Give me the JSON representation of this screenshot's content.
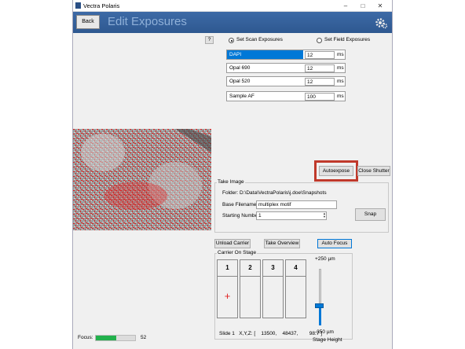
{
  "window": {
    "title": "Vectra Polaris",
    "min_icon": "minimize-icon",
    "max_icon": "maximize-icon",
    "close_icon": "close-icon"
  },
  "header": {
    "back_label": "Back",
    "title": "Edit Exposures",
    "settings_icon": "gear-icon"
  },
  "help_label": "?",
  "exposure_mode": {
    "scan_label": "Set Scan Exposures",
    "field_label": "Set Field Exposures",
    "selected": "scan"
  },
  "exposures": [
    {
      "name": "DAPI",
      "value": "12",
      "unit": "ms"
    },
    {
      "name": "Opal 690",
      "value": "12",
      "unit": "ms"
    },
    {
      "name": "Opal 520",
      "value": "12",
      "unit": "ms"
    },
    {
      "name": "Sample AF",
      "value": "100",
      "unit": "ms"
    }
  ],
  "buttons": {
    "autoexpose": "Autoexpose",
    "close_shutter": "Close Shutter",
    "snap": "Snap",
    "unload_carrier": "Unload Carrier",
    "take_overview": "Take Overview",
    "auto_focus": "Auto Focus"
  },
  "take_image": {
    "group_label": "Take Image",
    "folder_text": "Folder:  D:\\Data\\VectraPolaris\\j.doe\\Snapshots",
    "base_filename_label": "Base Filename:",
    "base_filename_value": "multiplex motif",
    "starting_number_label": "Starting Number:",
    "starting_number_value": "1"
  },
  "carrier": {
    "group_label": "Carrier On Stage",
    "slots": [
      "1",
      "2",
      "3",
      "4"
    ],
    "selected_marker": "+",
    "status_text": "Slide 1   X,Y,Z: [    13500,    48437,        98.7 ]",
    "stage_top": "+250 µm",
    "stage_bottom": "-350 µm",
    "stage_label": "Stage Height",
    "stage_level_fraction": 0.35
  },
  "focus": {
    "label": "Focus:",
    "value": "52",
    "fraction": 0.52
  },
  "colors": {
    "header_bg": "#3d6aa6",
    "selected_row": "#0078d7",
    "focus_bar": "#22b14c",
    "highlight": "#c0392b",
    "marker": "#e02020"
  }
}
